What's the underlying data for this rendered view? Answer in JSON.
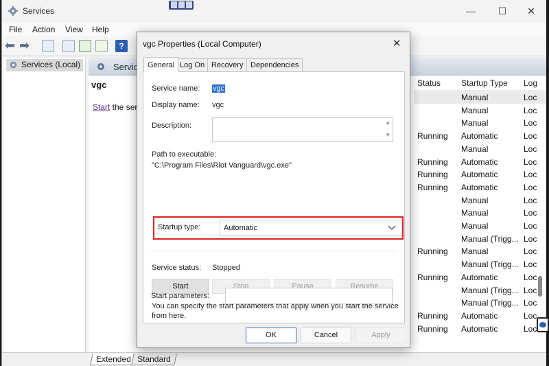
{
  "window": {
    "title": "Services"
  },
  "caption_buttons": {
    "minimize": "—",
    "maximize": "☐",
    "close": "✕"
  },
  "menu": [
    "File",
    "Action",
    "View",
    "Help"
  ],
  "tree": {
    "node": "Services (Local)"
  },
  "services_header": "Services",
  "extended": {
    "service_name": "vgc",
    "start_link": "Start",
    "start_rest": " the serv"
  },
  "columns": {
    "status": "Status",
    "startup_type": "Startup Type",
    "log_on": "Log"
  },
  "rows": [
    {
      "status": "",
      "startup": "Manual",
      "log": "Loc"
    },
    {
      "status": "",
      "startup": "Manual",
      "log": "Loc"
    },
    {
      "status": "",
      "startup": "Manual",
      "log": "Loc"
    },
    {
      "status": "Running",
      "startup": "Automatic",
      "log": "Loc"
    },
    {
      "status": "",
      "startup": "Manual",
      "log": "Loc"
    },
    {
      "status": "Running",
      "startup": "Automatic",
      "log": "Loc"
    },
    {
      "status": "Running",
      "startup": "Automatic",
      "log": "Loc"
    },
    {
      "status": "Running",
      "startup": "Automatic",
      "log": "Loc"
    },
    {
      "status": "",
      "startup": "Manual",
      "log": "Loc"
    },
    {
      "status": "",
      "startup": "Manual",
      "log": "Loc"
    },
    {
      "status": "",
      "startup": "Manual",
      "log": "Loc"
    },
    {
      "status": "",
      "startup": "Manual (Trigg...",
      "log": "Loc"
    },
    {
      "status": "Running",
      "startup": "Manual",
      "log": "Loc"
    },
    {
      "status": "",
      "startup": "Manual (Trigg...",
      "log": "Loc"
    },
    {
      "status": "Running",
      "startup": "Automatic",
      "log": "Loc"
    },
    {
      "status": "",
      "startup": "Manual (Trigg...",
      "log": "Loc"
    },
    {
      "status": "",
      "startup": "Manual (Trigg...",
      "log": "Loc"
    },
    {
      "status": "Running",
      "startup": "Automatic",
      "log": "Loc"
    },
    {
      "status": "Running",
      "startup": "Automatic",
      "log": "Loc"
    }
  ],
  "bottom_tabs": [
    "Extended",
    "Standard"
  ],
  "dialog": {
    "title": "vgc Properties (Local Computer)",
    "close": "✕",
    "tabs": [
      "General",
      "Log On",
      "Recovery",
      "Dependencies"
    ],
    "service_name_label": "Service name:",
    "service_name_value": "vgc",
    "display_name_label": "Display name:",
    "display_name_value": "vgc",
    "description_label": "Description:",
    "path_label": "Path to executable:",
    "path_value": "\"C:\\Program Files\\Riot Vanguard\\vgc.exe\"",
    "startup_type_label": "Startup type:",
    "startup_type_value": "Automatic",
    "service_status_label": "Service status:",
    "service_status_value": "Stopped",
    "btn_start": "Start",
    "btn_stop": "Stop",
    "btn_pause": "Pause",
    "btn_resume": "Resume",
    "hint_line1": "You can specify the start parameters that apply when you start the service",
    "hint_line2": "from here.",
    "start_params_label": "Start parameters:",
    "start_params_value": "",
    "ok": "OK",
    "cancel": "Cancel",
    "apply": "Apply"
  },
  "colors": {
    "highlight": "#e02020",
    "selection": "#2a6ed1",
    "link": "#5a2b8a"
  }
}
